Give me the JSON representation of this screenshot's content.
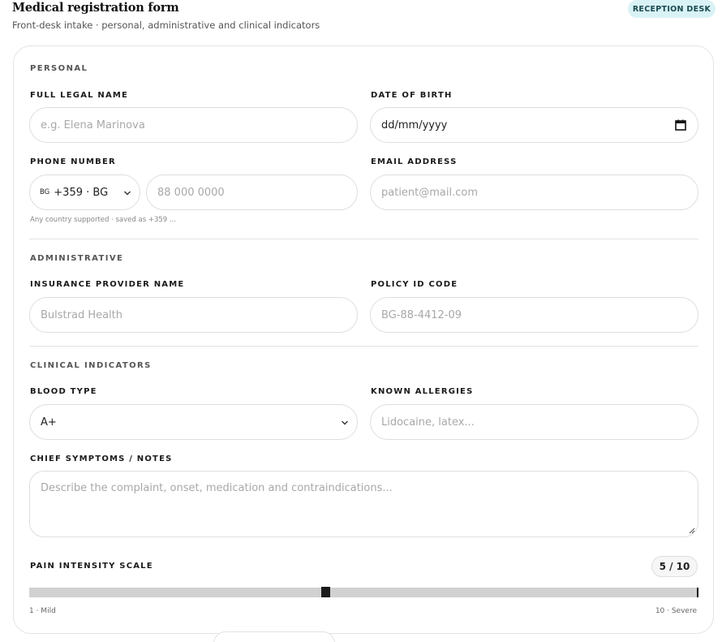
{
  "header": {
    "title": "Medical registration form",
    "subtitle": "Front-desk intake · personal, administrative and clinical indicators",
    "badge": "RECEPTION DESK"
  },
  "personal": {
    "section_label": "PERSONAL",
    "full_name": {
      "label": "FULL LEGAL NAME",
      "placeholder": "e.g. Elena Marinova"
    },
    "dob": {
      "label": "DATE OF BIRTH",
      "value": "dd/mm/yyyy"
    },
    "phone": {
      "label": "PHONE NUMBER",
      "country_flag": "BG",
      "country_value": "+359 · BG",
      "placeholder": "88 000 0000",
      "hint": "Any country supported · saved as +359 ..."
    },
    "email": {
      "label": "EMAIL ADDRESS",
      "placeholder": "patient@mail.com"
    }
  },
  "administrative": {
    "section_label": "ADMINISTRATIVE",
    "insurer": {
      "label": "INSURANCE PROVIDER NAME",
      "placeholder": "Bulstrad Health"
    },
    "policy": {
      "label": "POLICY ID CODE",
      "placeholder": "BG-88-4412-09"
    }
  },
  "clinical": {
    "section_label": "CLINICAL INDICATORS",
    "blood_type": {
      "label": "BLOOD TYPE",
      "value": "A+"
    },
    "allergies": {
      "label": "KNOWN ALLERGIES",
      "placeholder": "Lidocaine, latex..."
    },
    "symptoms": {
      "label": "CHIEF SYMPTOMS / NOTES",
      "placeholder": "Describe the complaint, onset, medication and contraindications..."
    },
    "pain": {
      "label": "PAIN INTENSITY SCALE",
      "value_text": "5 / 10",
      "value": 5,
      "min": 1,
      "max": 10,
      "min_label": "1 · Mild",
      "max_label": "10 · Severe"
    }
  },
  "icons": {
    "calendar": "calendar-icon",
    "chevron": "chevron-down-icon"
  },
  "colors": {
    "badge_bg": "#d9f2f5",
    "badge_text": "#1a4a52",
    "track": "#d1d1d1",
    "thumb": "#1a1a1a"
  }
}
